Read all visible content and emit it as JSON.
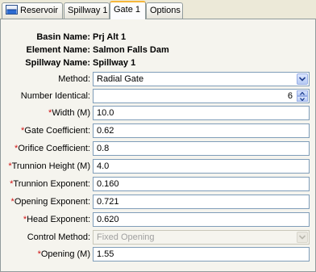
{
  "tabs": [
    {
      "label": "Reservoir",
      "icon": "reservoir-icon",
      "active": false
    },
    {
      "label": "Spillway 1",
      "active": false
    },
    {
      "label": "Gate 1",
      "active": true
    },
    {
      "label": "Options",
      "active": false
    }
  ],
  "info": {
    "basin_label": "Basin Name:",
    "basin_value": "Prj Alt 1",
    "element_label": "Element Name:",
    "element_value": "Salmon Falls Dam",
    "spillway_label": "Spillway Name:",
    "spillway_value": "Spillway 1"
  },
  "form": {
    "required_marker": "*",
    "method": {
      "label": "Method:",
      "value": "Radial Gate"
    },
    "number_identical": {
      "label": "Number Identical:",
      "value": "6"
    },
    "width": {
      "label": "Width (M)",
      "value": "10.0"
    },
    "gate_coefficient": {
      "label": "Gate Coefficient:",
      "value": "0.62"
    },
    "orifice_coefficient": {
      "label": "Orifice Coefficient:",
      "value": "0.8"
    },
    "trunnion_height": {
      "label": "Trunnion Height (M)",
      "value": "4.0"
    },
    "trunnion_exponent": {
      "label": "Trunnion Exponent:",
      "value": "0.160"
    },
    "opening_exponent": {
      "label": "Opening Exponent:",
      "value": "0.721"
    },
    "head_exponent": {
      "label": "Head Exponent:",
      "value": "0.620"
    },
    "control_method": {
      "label": "Control Method:",
      "value": "Fixed Opening",
      "disabled": true
    },
    "opening": {
      "label": "Opening (M)",
      "value": "1.55"
    }
  },
  "colors": {
    "required": "#d01010",
    "active_tab_accent": "#f6b73b",
    "field_border": "#7f9db9"
  }
}
